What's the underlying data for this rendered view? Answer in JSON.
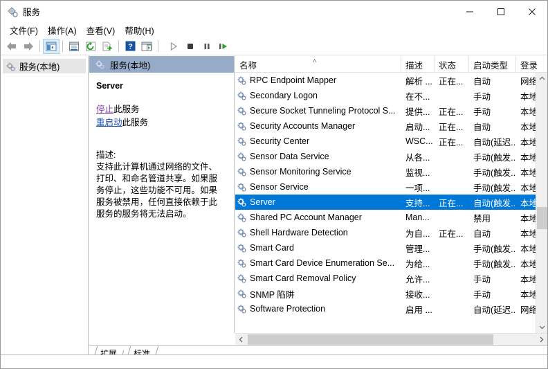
{
  "window": {
    "title": "服务",
    "icon": "services-gear-icon",
    "controls": {
      "minimize": "minimize-icon",
      "maximize": "maximize-icon",
      "close": "close-icon"
    }
  },
  "menubar": {
    "items": [
      {
        "label": "文件(F)",
        "name": "menu-file"
      },
      {
        "label": "操作(A)",
        "name": "menu-action"
      },
      {
        "label": "查看(V)",
        "name": "menu-view"
      },
      {
        "label": "帮助(H)",
        "name": "menu-help"
      }
    ]
  },
  "toolbar": {
    "buttons": [
      {
        "name": "back-button",
        "icon": "arrow-left-icon"
      },
      {
        "name": "forward-button",
        "icon": "arrow-right-icon"
      },
      {
        "name": "show-hide-tree-button",
        "icon": "tree-panel-icon"
      },
      {
        "name": "properties-button",
        "icon": "properties-icon"
      },
      {
        "name": "refresh-button",
        "icon": "refresh-icon"
      },
      {
        "name": "export-list-button",
        "icon": "export-icon"
      },
      {
        "name": "help-button",
        "icon": "help-icon"
      },
      {
        "name": "show-action-pane-button",
        "icon": "action-pane-icon"
      },
      {
        "name": "start-service-button",
        "icon": "play-icon"
      },
      {
        "name": "stop-service-button",
        "icon": "stop-icon"
      },
      {
        "name": "pause-service-button",
        "icon": "pause-icon"
      },
      {
        "name": "restart-service-button",
        "icon": "restart-icon"
      }
    ]
  },
  "tree": {
    "items": [
      {
        "label": "服务(本地)",
        "name": "tree-item-services-local",
        "icon": "services-gear-icon"
      }
    ]
  },
  "details": {
    "header": "服务(本地)",
    "header_icon": "services-gear-icon",
    "service_name": "Server",
    "links": [
      {
        "action": "停止",
        "suffix": "此服务",
        "name": "stop-service-link",
        "state": "visited"
      },
      {
        "action": "重启动",
        "suffix": "此服务",
        "name": "restart-service-link",
        "state": "normal"
      }
    ],
    "description_label": "描述:",
    "description": "支持此计算机通过网络的文件、打印、和命名管道共享。如果服务停止，这些功能不可用。如果服务被禁用，任何直接依赖于此服务的服务将无法启动。"
  },
  "list": {
    "columns": [
      {
        "label": "名称",
        "name": "column-header-name",
        "sorted": "asc"
      },
      {
        "label": "描述",
        "name": "column-header-description"
      },
      {
        "label": "状态",
        "name": "column-header-status"
      },
      {
        "label": "启动类型",
        "name": "column-header-startup-type"
      },
      {
        "label": "登录",
        "name": "column-header-logon"
      }
    ],
    "sort_indicator": "˄",
    "rows": [
      {
        "name": "RPC Endpoint Mapper",
        "desc": "解析 ...",
        "state": "正在...",
        "start": "自动",
        "logon": "网络",
        "selected": false
      },
      {
        "name": "Secondary Logon",
        "desc": "在不...",
        "state": "",
        "start": "手动",
        "logon": "本地",
        "selected": false
      },
      {
        "name": "Secure Socket Tunneling Protocol S...",
        "desc": "提供...",
        "state": "正在...",
        "start": "手动",
        "logon": "本地",
        "selected": false
      },
      {
        "name": "Security Accounts Manager",
        "desc": "启动...",
        "state": "正在...",
        "start": "自动",
        "logon": "本地",
        "selected": false
      },
      {
        "name": "Security Center",
        "desc": "WSC...",
        "state": "正在...",
        "start": "自动(延迟...",
        "logon": "本地",
        "selected": false
      },
      {
        "name": "Sensor Data Service",
        "desc": "从各...",
        "state": "",
        "start": "手动(触发...",
        "logon": "本地",
        "selected": false
      },
      {
        "name": "Sensor Monitoring Service",
        "desc": "监视...",
        "state": "",
        "start": "手动(触发...",
        "logon": "本地",
        "selected": false
      },
      {
        "name": "Sensor Service",
        "desc": "一项...",
        "state": "",
        "start": "手动(触发...",
        "logon": "本地",
        "selected": false
      },
      {
        "name": "Server",
        "desc": "支持...",
        "state": "正在...",
        "start": "自动(触发...",
        "logon": "本地",
        "selected": true
      },
      {
        "name": "Shared PC Account Manager",
        "desc": "Man...",
        "state": "",
        "start": "禁用",
        "logon": "本地",
        "selected": false
      },
      {
        "name": "Shell Hardware Detection",
        "desc": "为自...",
        "state": "正在...",
        "start": "自动",
        "logon": "本地",
        "selected": false
      },
      {
        "name": "Smart Card",
        "desc": "管理...",
        "state": "",
        "start": "手动(触发...",
        "logon": "本地",
        "selected": false
      },
      {
        "name": "Smart Card Device Enumeration Se...",
        "desc": "为给...",
        "state": "",
        "start": "手动(触发...",
        "logon": "本地",
        "selected": false
      },
      {
        "name": "Smart Card Removal Policy",
        "desc": "允许...",
        "state": "",
        "start": "手动",
        "logon": "本地",
        "selected": false
      },
      {
        "name": "SNMP 陷阱",
        "desc": "接收...",
        "state": "",
        "start": "手动",
        "logon": "本地",
        "selected": false
      },
      {
        "name": "Software Protection",
        "desc": "启用 ...",
        "state": "",
        "start": "自动(延迟...",
        "logon": "网络",
        "selected": false
      }
    ],
    "row_icon": "services-gear-icon"
  },
  "tabs": [
    {
      "label": "扩展",
      "name": "tab-extended",
      "active": false
    },
    {
      "label": "标准",
      "name": "tab-standard",
      "active": true
    }
  ],
  "scrollbars": {
    "vertical": {
      "up": "chevron-up-icon",
      "down": "chevron-down-icon"
    },
    "horizontal": {
      "left": "chevron-left-icon",
      "right": "chevron-right-icon"
    }
  },
  "colors": {
    "selection": "#0078d7",
    "pane_header": "#96abc8",
    "link_visited": "#7a3b9e",
    "link_normal": "#1b54b5"
  }
}
